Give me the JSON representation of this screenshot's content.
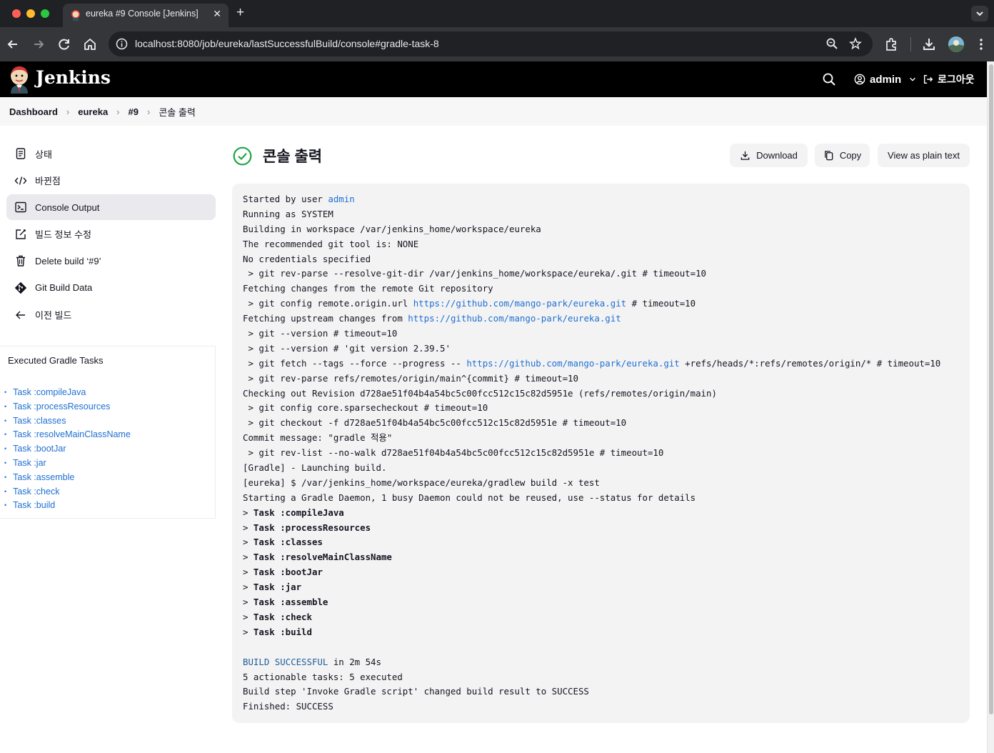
{
  "browser": {
    "tab_title": "eureka #9 Console [Jenkins]",
    "url_host": "localhost",
    "url_rest": ":8080/job/eureka/lastSuccessfulBuild/console#gradle-task-8"
  },
  "header": {
    "brand": "Jenkins",
    "user": "admin",
    "logout": "로그아웃"
  },
  "breadcrumb": [
    "Dashboard",
    "eureka",
    "#9",
    "콘솔 출력"
  ],
  "sidebar": {
    "items": [
      {
        "label": "상태",
        "icon": "document-icon"
      },
      {
        "label": "바뀐점",
        "icon": "code-icon"
      },
      {
        "label": "Console Output",
        "icon": "terminal-icon",
        "active": true
      },
      {
        "label": "빌드 정보 수정",
        "icon": "edit-icon"
      },
      {
        "label": "Delete build ‘#9’",
        "icon": "trash-icon"
      },
      {
        "label": "Git Build Data",
        "icon": "git-icon"
      },
      {
        "label": "이전 빌드",
        "icon": "arrow-left-icon"
      }
    ],
    "tasks_title": "Executed Gradle Tasks",
    "tasks": [
      "Task :compileJava",
      "Task :processResources",
      "Task :classes",
      "Task :resolveMainClassName",
      "Task :bootJar",
      "Task :jar",
      "Task :assemble",
      "Task :check",
      "Task :build"
    ]
  },
  "main": {
    "title": "콘솔 출력",
    "download_label": "Download",
    "copy_label": "Copy",
    "plain_label": "View as plain text"
  },
  "colors": {
    "accent": "#1f6fd1",
    "success": "#1ea446",
    "header_bg": "#000000"
  },
  "console": {
    "lines": [
      [
        {
          "t": "Started by user "
        },
        {
          "t": "admin",
          "c": "link"
        }
      ],
      [
        {
          "t": "Running as SYSTEM"
        }
      ],
      [
        {
          "t": "Building in workspace /var/jenkins_home/workspace/eureka"
        }
      ],
      [
        {
          "t": "The recommended git tool is: NONE"
        }
      ],
      [
        {
          "t": "No credentials specified"
        }
      ],
      [
        {
          "t": " > git rev-parse --resolve-git-dir /var/jenkins_home/workspace/eureka/.git # timeout=10"
        }
      ],
      [
        {
          "t": "Fetching changes from the remote Git repository"
        }
      ],
      [
        {
          "t": " > git config remote.origin.url "
        },
        {
          "t": "https://github.com/mango-park/eureka.git",
          "c": "link"
        },
        {
          "t": " # timeout=10"
        }
      ],
      [
        {
          "t": "Fetching upstream changes from "
        },
        {
          "t": "https://github.com/mango-park/eureka.git",
          "c": "link"
        }
      ],
      [
        {
          "t": " > git --version # timeout=10"
        }
      ],
      [
        {
          "t": " > git --version # 'git version 2.39.5'"
        }
      ],
      [
        {
          "t": " > git fetch --tags --force --progress -- "
        },
        {
          "t": "https://github.com/mango-park/eureka.git",
          "c": "link"
        },
        {
          "t": " +refs/heads/*:refs/remotes/origin/* # timeout=10"
        }
      ],
      [
        {
          "t": " > git rev-parse refs/remotes/origin/main^{commit} # timeout=10"
        }
      ],
      [
        {
          "t": "Checking out Revision d728ae51f04b4a54bc5c00fcc512c15c82d5951e (refs/remotes/origin/main)"
        }
      ],
      [
        {
          "t": " > git config core.sparsecheckout # timeout=10"
        }
      ],
      [
        {
          "t": " > git checkout -f d728ae51f04b4a54bc5c00fcc512c15c82d5951e # timeout=10"
        }
      ],
      [
        {
          "t": "Commit message: \"gradle 적용\""
        }
      ],
      [
        {
          "t": " > git rev-list --no-walk d728ae51f04b4a54bc5c00fcc512c15c82d5951e # timeout=10"
        }
      ],
      [
        {
          "t": "[Gradle] - Launching build."
        }
      ],
      [
        {
          "t": "[eureka] $ /var/jenkins_home/workspace/eureka/gradlew build -x test"
        }
      ],
      [
        {
          "t": "Starting a Gradle Daemon, 1 busy Daemon could not be reused, use --status for details"
        }
      ],
      [
        {
          "t": "> "
        },
        {
          "t": "Task :compileJava",
          "c": "bold"
        }
      ],
      [
        {
          "t": "> "
        },
        {
          "t": "Task :processResources",
          "c": "bold"
        }
      ],
      [
        {
          "t": "> "
        },
        {
          "t": "Task :classes",
          "c": "bold"
        }
      ],
      [
        {
          "t": "> "
        },
        {
          "t": "Task :resolveMainClassName",
          "c": "bold"
        }
      ],
      [
        {
          "t": "> "
        },
        {
          "t": "Task :bootJar",
          "c": "bold"
        }
      ],
      [
        {
          "t": "> "
        },
        {
          "t": "Task :jar",
          "c": "bold"
        }
      ],
      [
        {
          "t": "> "
        },
        {
          "t": "Task :assemble",
          "c": "bold"
        }
      ],
      [
        {
          "t": "> "
        },
        {
          "t": "Task :check",
          "c": "bold"
        }
      ],
      [
        {
          "t": "> "
        },
        {
          "t": "Task :build",
          "c": "bold"
        }
      ],
      [
        {
          "t": ""
        }
      ],
      [
        {
          "t": "BUILD SUCCESSFUL",
          "c": "green"
        },
        {
          "t": " in 2m 54s"
        }
      ],
      [
        {
          "t": "5 actionable tasks: 5 executed"
        }
      ],
      [
        {
          "t": "Build step 'Invoke Gradle script' changed build result to SUCCESS"
        }
      ],
      [
        {
          "t": "Finished: SUCCESS"
        }
      ]
    ]
  }
}
